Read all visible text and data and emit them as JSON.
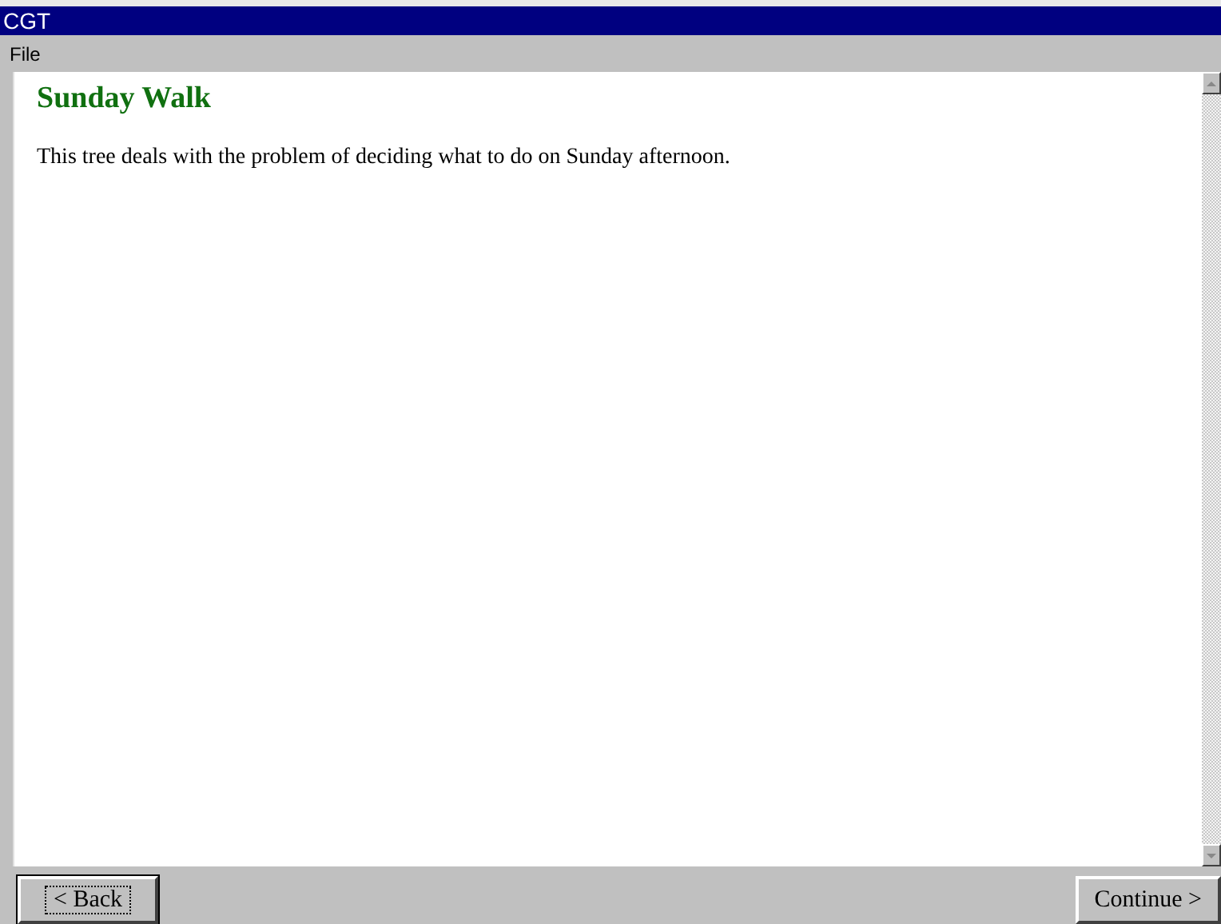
{
  "window": {
    "title": "CGT"
  },
  "menu": [
    {
      "label": "File"
    }
  ],
  "content": {
    "heading": "Sunday Walk",
    "text": "This tree deals with the problem of deciding what to do on Sunday afternoon."
  },
  "buttons": [
    {
      "label": "< Back",
      "focused": true
    },
    {
      "label": "Continue >",
      "focused": false
    }
  ]
}
